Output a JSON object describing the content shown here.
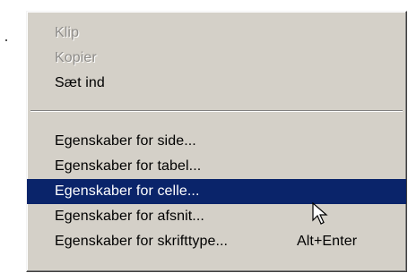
{
  "context_menu": {
    "items_top": [
      {
        "label": "Klip",
        "state": "disabled"
      },
      {
        "label": "Kopier",
        "state": "disabled"
      },
      {
        "label": "Sæt ind",
        "state": "enabled"
      }
    ],
    "items_bottom": [
      {
        "label": "Egenskaber for side...",
        "state": "enabled"
      },
      {
        "label": "Egenskaber for tabel...",
        "state": "enabled"
      },
      {
        "label": "Egenskaber for celle...",
        "state": "highlighted"
      },
      {
        "label": "Egenskaber for afsnit...",
        "state": "enabled"
      },
      {
        "label": "Egenskaber for skrifttype...",
        "shortcut": "Alt+Enter",
        "state": "enabled"
      }
    ]
  },
  "colors": {
    "menu_background": "#d4d0c8",
    "highlight_background": "#0a246a",
    "highlight_text": "#ffffff",
    "disabled_text": "#8e8c89"
  },
  "cursor_icon": "arrow-pointer-icon"
}
